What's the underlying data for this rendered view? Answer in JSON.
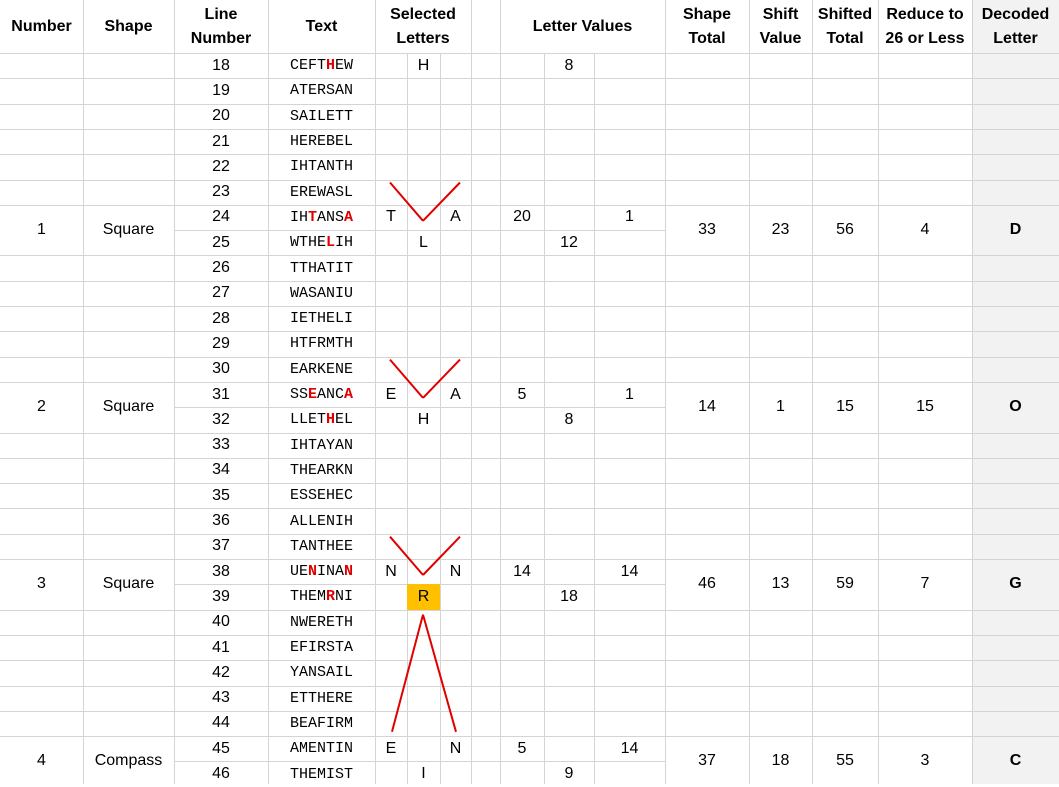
{
  "headers": {
    "number": "Number",
    "shape": "Shape",
    "line_number": [
      "Line",
      "Number"
    ],
    "text": "Text",
    "selected_letters": [
      "Selected",
      "Letters"
    ],
    "letter_values": "Letter Values",
    "shape_total": [
      "Shape",
      "Total"
    ],
    "shift_value": [
      "Shift",
      "Value"
    ],
    "shifted_total": [
      "Shifted",
      "Total"
    ],
    "reduce": [
      "Reduce to",
      "26 or Less"
    ],
    "decoded_letter": [
      "Decoded",
      "Letter"
    ]
  },
  "rows": [
    {
      "line": "18",
      "text": "CEFTHEW",
      "hl": [
        4
      ],
      "sel": {
        "mid": "H"
      },
      "val": {
        "mid": "8"
      }
    },
    {
      "line": "19",
      "text": "ATERSAN",
      "hl": []
    },
    {
      "line": "20",
      "text": "SAILETT",
      "hl": []
    },
    {
      "line": "21",
      "text": "HEREBEL",
      "hl": []
    },
    {
      "line": "22",
      "text": "IHTANTH",
      "hl": []
    },
    {
      "line": "23",
      "text": "EREWASL",
      "hl": []
    },
    {
      "line": "24",
      "text": "IHTANSA",
      "hl": [
        2,
        6
      ],
      "sel": {
        "left": "T",
        "right": "A"
      },
      "val": {
        "left": "20",
        "right": "1"
      }
    },
    {
      "line": "25",
      "text": "WTHELIH",
      "hl": [
        4
      ],
      "sel": {
        "mid": "L"
      },
      "val": {
        "mid": "12"
      }
    },
    {
      "line": "26",
      "text": "TTHATIT",
      "hl": []
    },
    {
      "line": "27",
      "text": "WASANIU",
      "hl": []
    },
    {
      "line": "28",
      "text": "IETHELI",
      "hl": []
    },
    {
      "line": "29",
      "text": "HTFRMTH",
      "hl": []
    },
    {
      "line": "30",
      "text": "EARKENE",
      "hl": []
    },
    {
      "line": "31",
      "text": "SSEANCA",
      "hl": [
        2,
        6
      ],
      "sel": {
        "left": "E",
        "right": "A"
      },
      "val": {
        "left": "5",
        "right": "1"
      }
    },
    {
      "line": "32",
      "text": "LLETHEL",
      "hl": [
        4
      ],
      "sel": {
        "mid": "H"
      },
      "val": {
        "mid": "8"
      }
    },
    {
      "line": "33",
      "text": "IHTAYAN",
      "hl": []
    },
    {
      "line": "34",
      "text": "THEARKN",
      "hl": []
    },
    {
      "line": "35",
      "text": "ESSEHEC",
      "hl": []
    },
    {
      "line": "36",
      "text": "ALLENIH",
      "hl": []
    },
    {
      "line": "37",
      "text": "TANTHEE",
      "hl": []
    },
    {
      "line": "38",
      "text": "UENINAN",
      "hl": [
        2,
        6
      ],
      "sel": {
        "left": "N",
        "right": "N"
      },
      "val": {
        "left": "14",
        "right": "14"
      }
    },
    {
      "line": "39",
      "text": "THEMRNI",
      "hl": [
        4
      ],
      "sel": {
        "mid": "R",
        "mid_fill": "#ffc000"
      },
      "val": {
        "mid": "18"
      }
    },
    {
      "line": "40",
      "text": "NWERETH",
      "hl": []
    },
    {
      "line": "41",
      "text": "EFIRSTA",
      "hl": []
    },
    {
      "line": "42",
      "text": "YANSAIL",
      "hl": []
    },
    {
      "line": "43",
      "text": "ETTHERE",
      "hl": []
    },
    {
      "line": "44",
      "text": "BEAFIRM",
      "hl": []
    },
    {
      "line": "45",
      "text": "AMENTIN",
      "hl": [],
      "sel": {
        "left": "E",
        "right": "N"
      },
      "val": {
        "left": "5",
        "right": "14"
      }
    },
    {
      "line": "46",
      "text": "THEMIST",
      "hl": [],
      "sel": {
        "mid": "I"
      },
      "val": {
        "mid": "9"
      }
    }
  ],
  "groups": [
    {
      "number": "1",
      "shape": "Square",
      "shape_total": "33",
      "shift": "23",
      "shifted": "56",
      "reduced": "4",
      "decoded": "D",
      "first_row": 6
    },
    {
      "number": "2",
      "shape": "Square",
      "shape_total": "14",
      "shift": "1",
      "shifted": "15",
      "reduced": "15",
      "decoded": "O",
      "first_row": 13
    },
    {
      "number": "3",
      "shape": "Square",
      "shape_total": "46",
      "shift": "13",
      "shifted": "59",
      "reduced": "7",
      "decoded": "G",
      "first_row": 20
    },
    {
      "number": "4",
      "shape": "Compass",
      "shape_total": "37",
      "shift": "18",
      "shifted": "55",
      "reduced": "3",
      "decoded": "C",
      "first_row": 27
    }
  ],
  "colors": {
    "grid": "#d4d4d4",
    "highlight_text": "#e00000",
    "arrow": "#e00000",
    "selected_fill": "#ffc000",
    "decoded_column_bg": "#f2f2f2"
  }
}
